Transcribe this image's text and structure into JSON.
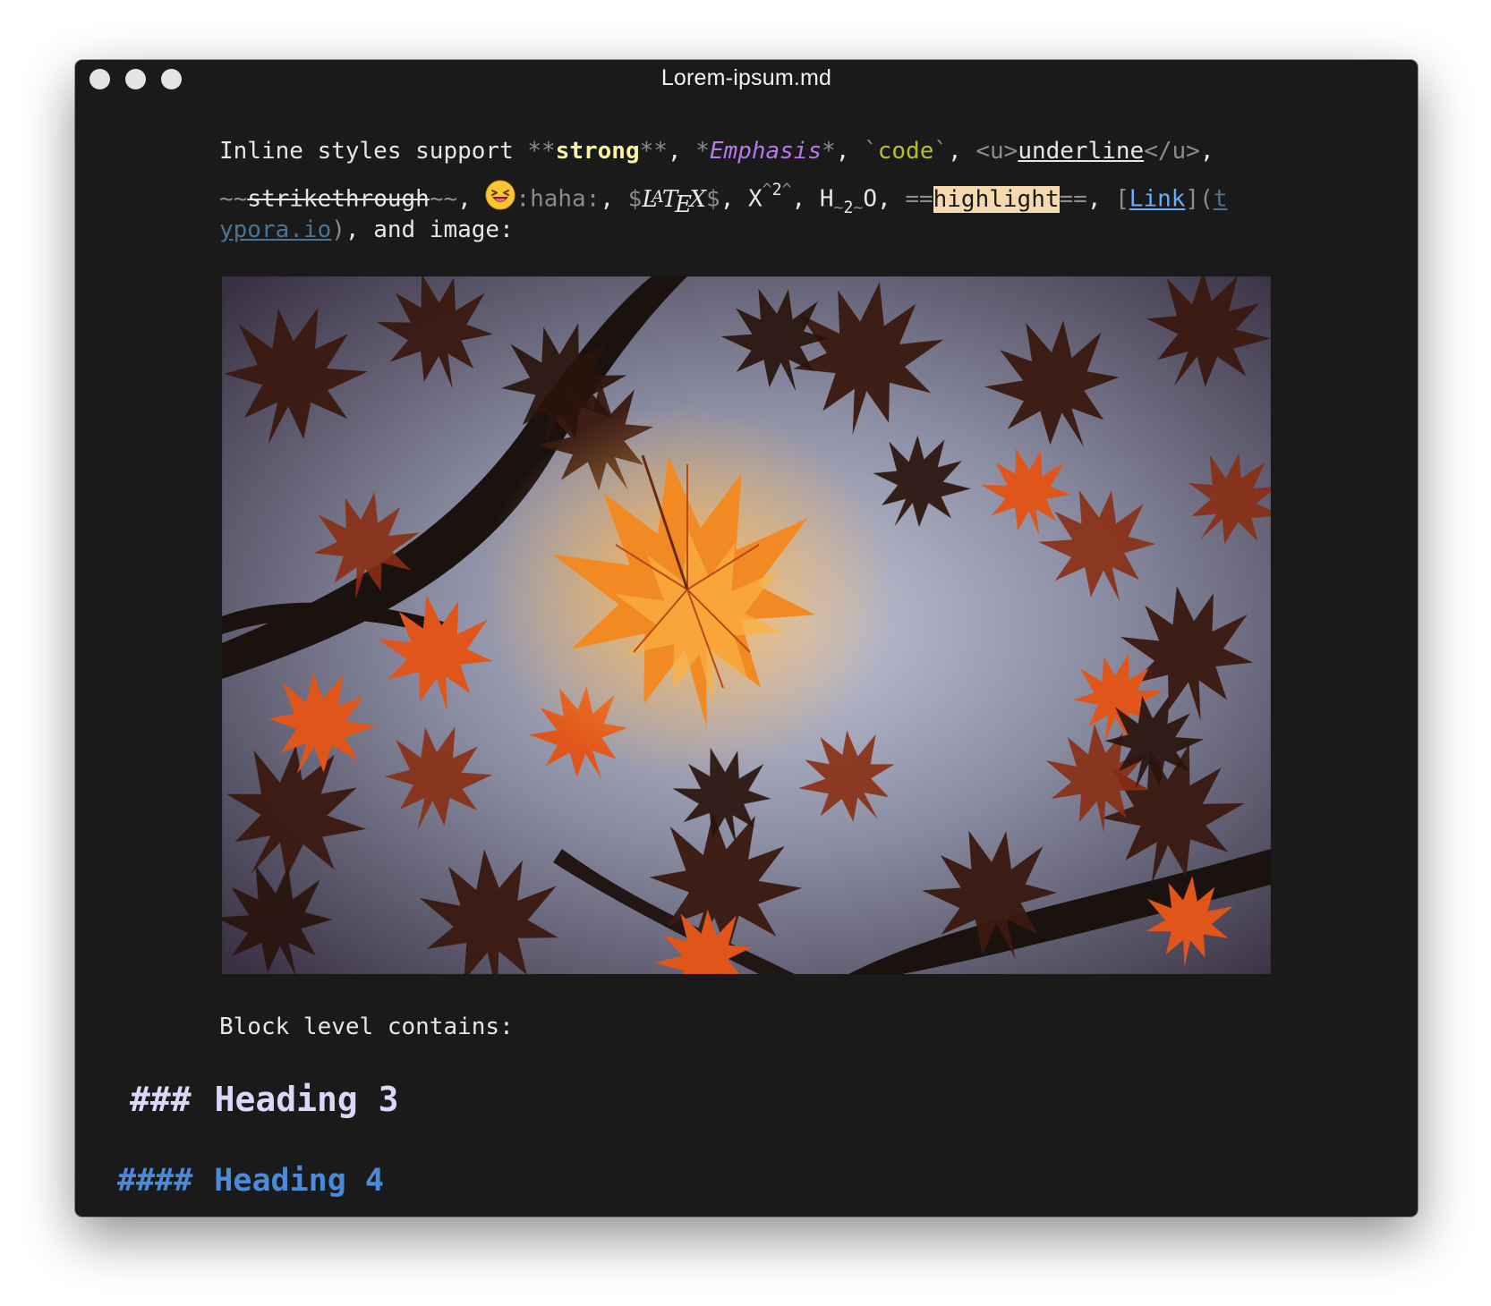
{
  "window": {
    "title": "Lorem-ipsum.md"
  },
  "paragraph": {
    "line1": {
      "intro": "Inline styles support ",
      "strong_open": "**",
      "strong": "strong",
      "strong_close": "**",
      "sep1": ", ",
      "em_open": "*",
      "em": "Emphasis",
      "em_close": "*",
      "sep2": ", ",
      "code_open": "`",
      "code": "code",
      "code_close": "`",
      "sep3": ", ",
      "u_open": "<u>",
      "u": "underline",
      "u_close": "</u>",
      "sep4": ","
    },
    "line2": {
      "strike_open": "~~",
      "strike": "strikethrough",
      "strike_close": "~~",
      "sep1": ", ",
      "emoji_code": ":haha:",
      "sep2": ", ",
      "latex_open": "$",
      "latex_l": "L",
      "latex_a": "A",
      "latex_t": "T",
      "latex_e": "E",
      "latex_x": "X",
      "latex_close": "$",
      "sep3": ", ",
      "sup_base": "X",
      "sup_open": "^",
      "sup": "2",
      "sup_close": "^",
      "sep4": ", ",
      "sub_base": "H",
      "sub_open": "~",
      "sub": "2",
      "sub_close": "~",
      "sub_after": "O",
      "sep5": ", ",
      "hl_open": "==",
      "hl": "highlight",
      "hl_close": "==",
      "sep6": ", ",
      "link_open": "[",
      "link": "Link",
      "link_mid": "](",
      "url_start": "t"
    },
    "line3": {
      "url_end": "ypora.io",
      "link_close": ")",
      "tail": ", and image:"
    }
  },
  "image": {
    "alt": "autumn maple leaves"
  },
  "block_label": "Block level contains:",
  "heading3": {
    "marker": "###",
    "text": "Heading 3"
  },
  "heading4": {
    "marker": "####",
    "text": "Heading 4"
  },
  "colors": {
    "background": "#1a1a1a",
    "strong": "#fbf3a0",
    "emphasis": "#b579e8",
    "code": "#b8bf27",
    "highlight_bg": "#f6d9ae",
    "link": "#6aaef8",
    "heading3": "#dcd7f8",
    "heading4": "#4a8ad8"
  },
  "icons": {
    "emoji": "laughing-face-icon"
  }
}
